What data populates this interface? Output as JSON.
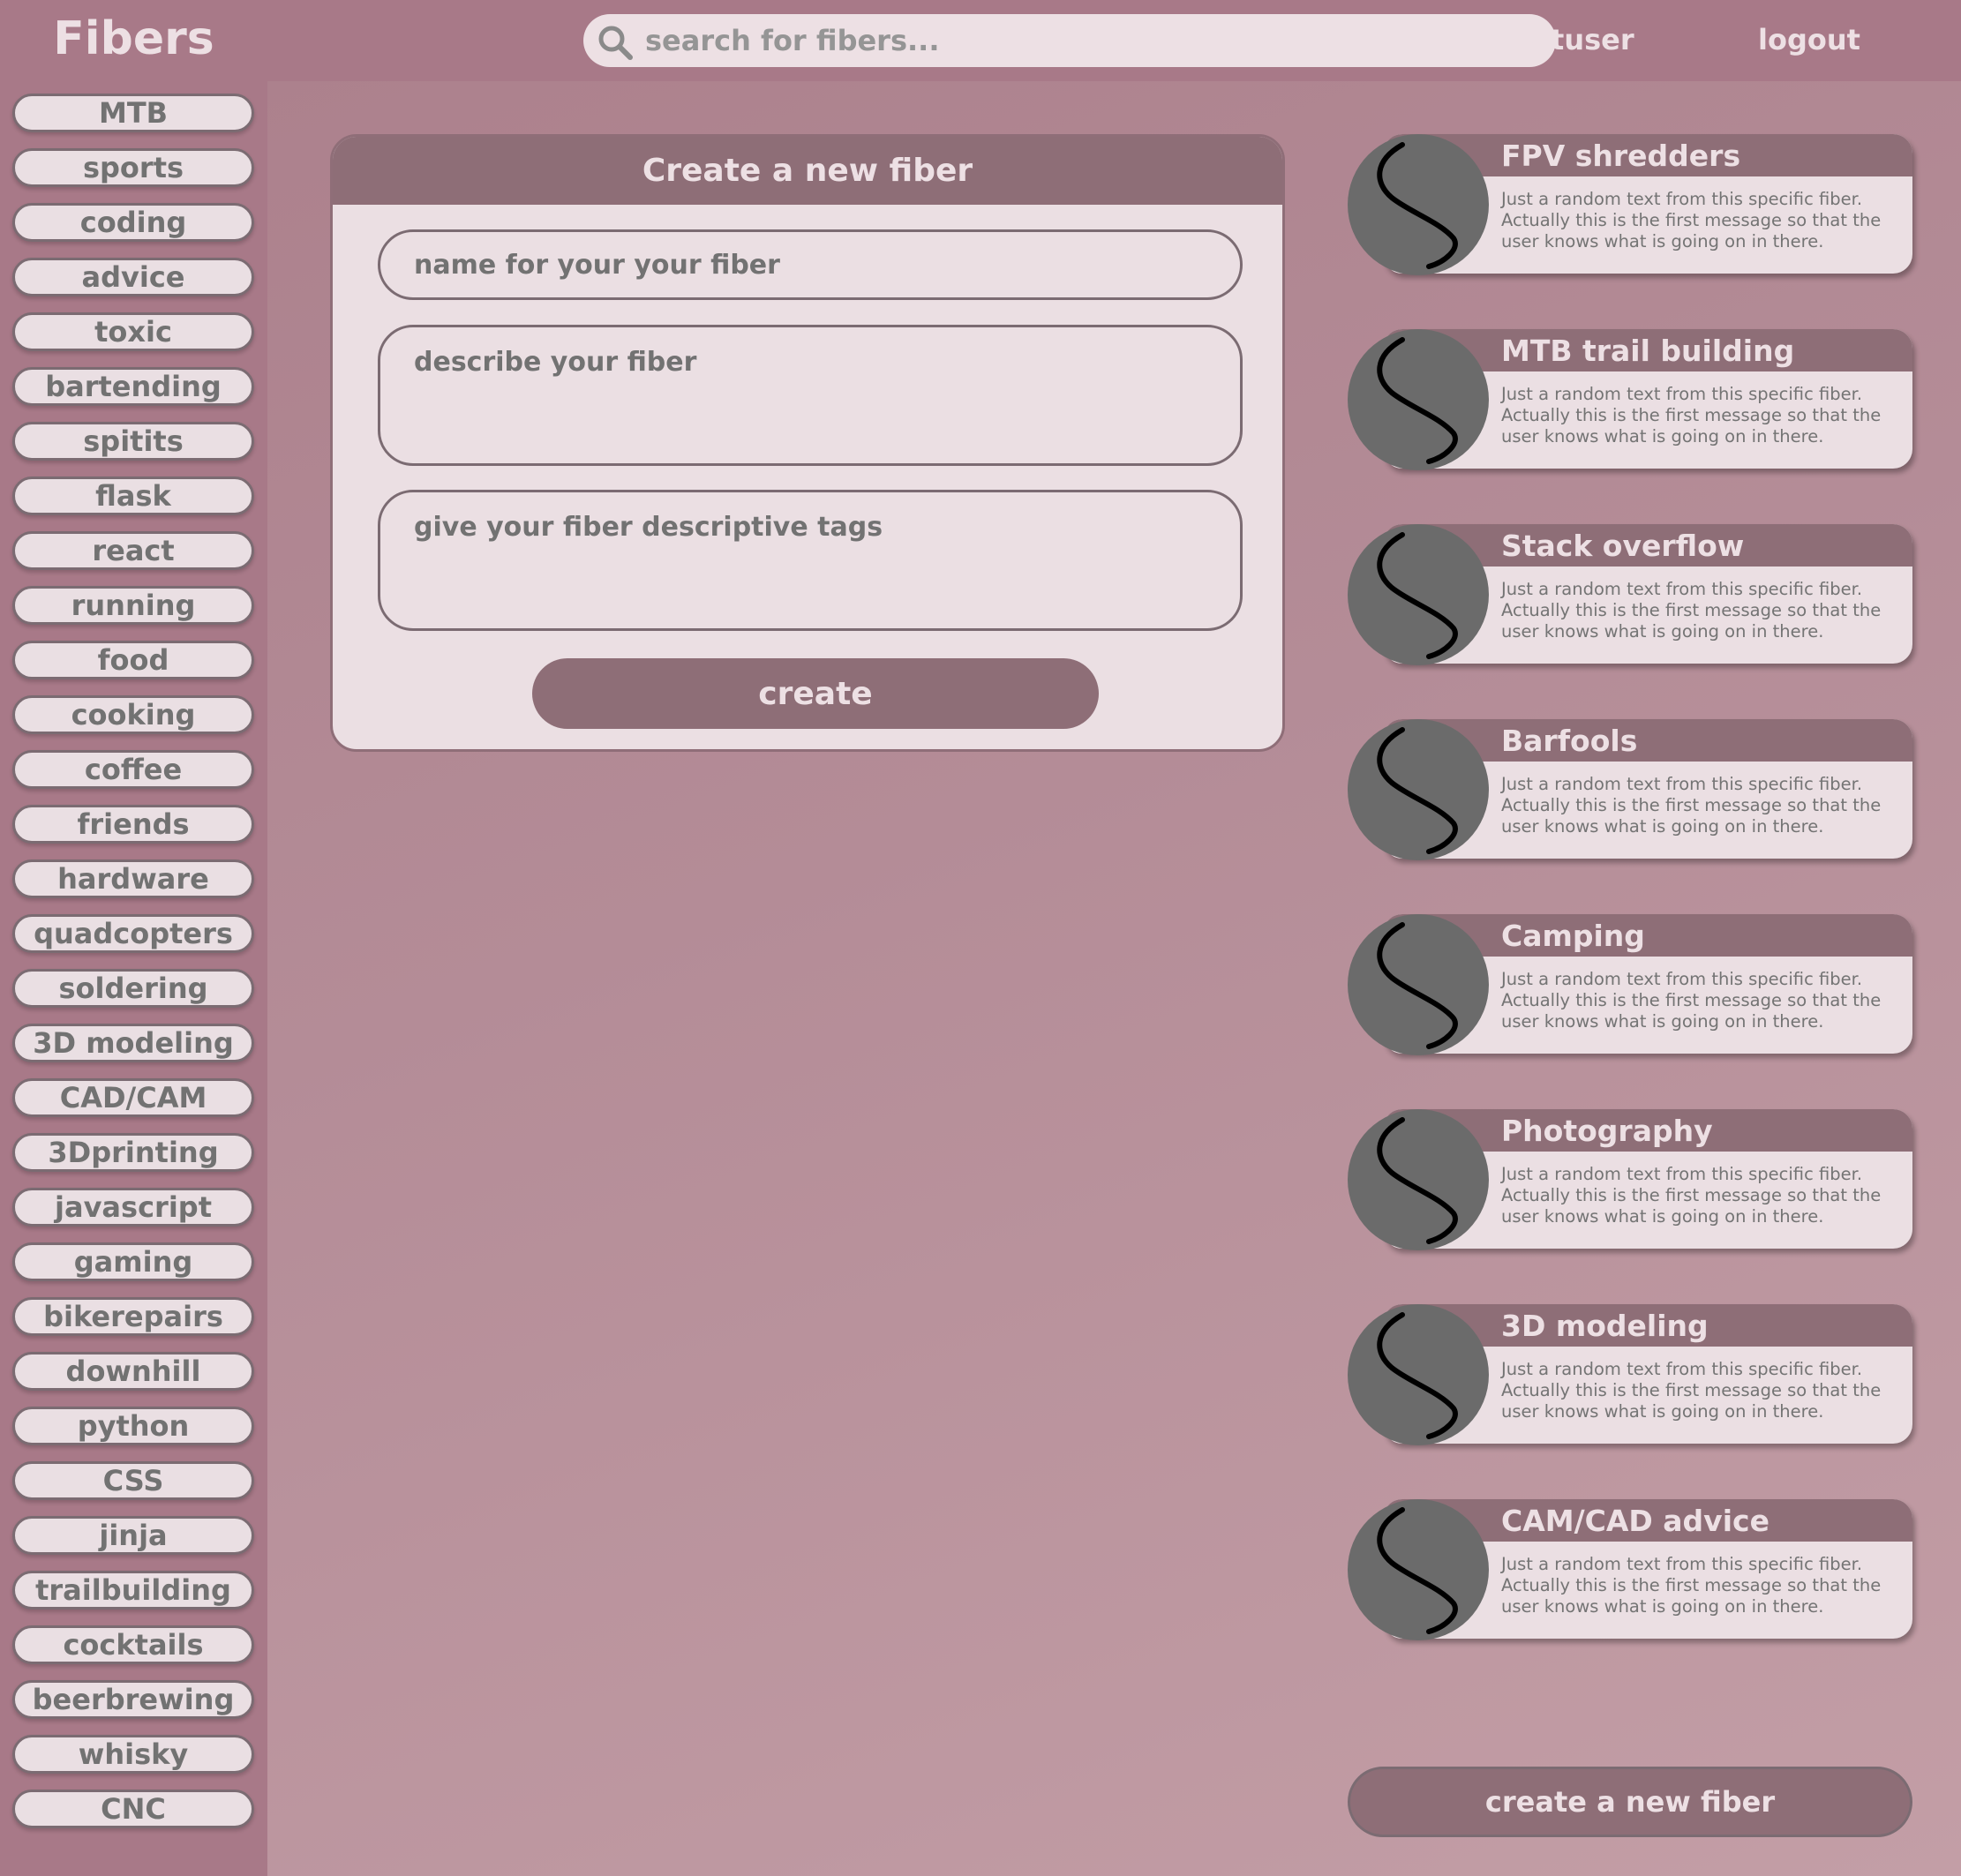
{
  "app": {
    "title": "Fibers"
  },
  "search": {
    "placeholder": "search for fibers...",
    "value": ""
  },
  "user": {
    "name": "testuser",
    "logout_label": "logout"
  },
  "sidebar": {
    "tags": [
      "MTB",
      "sports",
      "coding",
      "advice",
      "toxic",
      "bartending",
      "spitits",
      "flask",
      "react",
      "running",
      "food",
      "cooking",
      "coffee",
      "friends",
      "hardware",
      "quadcopters",
      "soldering",
      "3D modeling",
      "CAD/CAM",
      "3Dprinting",
      "javascript",
      "gaming",
      "bikerepairs",
      "downhill",
      "python",
      "CSS",
      "jinja",
      "trailbuilding",
      "cocktails",
      "beerbrewing",
      "whisky",
      "CNC"
    ]
  },
  "create_form": {
    "title": "Create a new fiber",
    "name_placeholder": "name for your your fiber",
    "description_placeholder": "describe your fiber",
    "tags_placeholder": "give your fiber descriptive tags",
    "submit_label": "create"
  },
  "fibers": [
    {
      "title": "FPV shredders",
      "text": "Just a random text from this specific fiber. Actually this is the first message so that the user knows what is going on in there."
    },
    {
      "title": "MTB trail building",
      "text": "Just a random text from this specific fiber. Actually this is the first message so that the user knows what is going on in there."
    },
    {
      "title": "Stack overflow",
      "text": "Just a random text from this specific fiber. Actually this is the first message so that the user knows what is going on in there."
    },
    {
      "title": "Barfools",
      "text": "Just a random text from this specific fiber. Actually this is the first message so that the user knows what is going on in there."
    },
    {
      "title": "Camping",
      "text": "Just a random text from this specific fiber. Actually this is the first message so that the user knows what is going on in there."
    },
    {
      "title": "Photography",
      "text": "Just a random text from this specific fiber. Actually this is the first message so that the user knows what is going on in there."
    },
    {
      "title": "3D modeling",
      "text": "Just a random text from this specific fiber. Actually this is the first message so that the user knows what is going on in there."
    },
    {
      "title": "CAM/CAD advice",
      "text": "Just a random text from this specific fiber. Actually this is the first message so that the user knows what is going on in there."
    }
  ],
  "footer": {
    "create_button_label": "create a new fiber"
  },
  "colors": {
    "sidebar": "#a87988",
    "accent": "#8e6e77",
    "surface": "#ebdfe3",
    "avatar": "#6b6b6b"
  },
  "icons": {
    "search": "search-icon",
    "fiber_avatar": "squiggle-avatar-icon"
  }
}
